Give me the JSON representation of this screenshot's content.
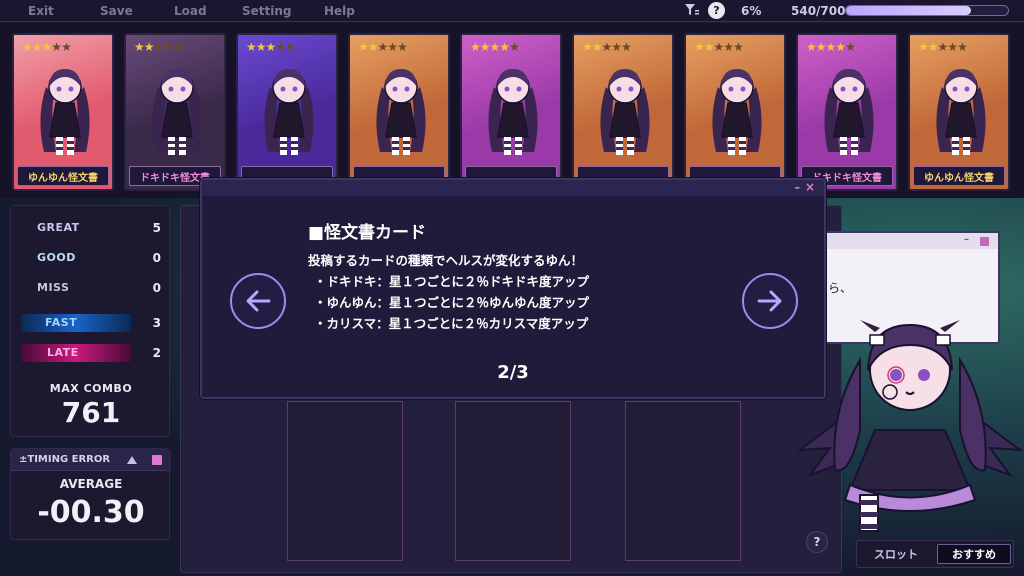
{
  "menu": {
    "exit": "Exit",
    "save": "Save",
    "load": "Load",
    "setting": "Setting",
    "help": "Help"
  },
  "status": {
    "help_icon_label": "?",
    "percent": "6%",
    "count": "540/700",
    "progress_fraction": 0.771
  },
  "cards": [
    {
      "stars": 3,
      "label": "ゆんゆん怪文書",
      "theme": "red"
    },
    {
      "stars": 2,
      "label": "ドキドキ怪文書",
      "theme": "dark"
    },
    {
      "stars": 3,
      "label": "",
      "theme": "purple"
    },
    {
      "stars": 2,
      "label": "",
      "theme": "orange"
    },
    {
      "stars": 4,
      "label": "",
      "theme": "magenta"
    },
    {
      "stars": 2,
      "label": "",
      "theme": "orange"
    },
    {
      "stars": 2,
      "label": "",
      "theme": "orange"
    },
    {
      "stars": 4,
      "label": "ドキドキ怪文書",
      "theme": "magenta"
    },
    {
      "stars": 2,
      "label": "ゆんゆん怪文書",
      "theme": "orange"
    }
  ],
  "judgements": {
    "great_label": "GREAT",
    "great": "5",
    "good_label": "GOOD",
    "good": "0",
    "miss_label": "MISS",
    "miss": "0",
    "fast_label": "FAST",
    "fast": "3",
    "late_label": "LATE",
    "late": "2"
  },
  "max_combo": {
    "label": "MAX COMBO",
    "value": "761"
  },
  "timing": {
    "title": "±TIMING ERROR",
    "average_label": "AVERAGE",
    "average_value": "-00.30"
  },
  "modal": {
    "minimize": "–",
    "close": "×",
    "title": "■怪文書カード",
    "intro": "投稿するカードの種類でヘルスが変化するゆん！",
    "lines": [
      "・ドキドキ：星１つごとに２％ドキドキ度アップ",
      "・ゆんゆん：星１つごとに２％ゆんゆん度アップ",
      "・カリスマ：星１つごとに２％カリスマ度アップ"
    ],
    "page": "2/3"
  },
  "right_dialog": {
    "minimize": "–",
    "text": "ら、"
  },
  "bottom": {
    "help": "?",
    "tab_slot": "スロット",
    "tab_recommended": "おすすめ"
  },
  "colors": {
    "accent": "#9d8cf0",
    "pink": "#e07ad0",
    "star": "#f1c441"
  }
}
